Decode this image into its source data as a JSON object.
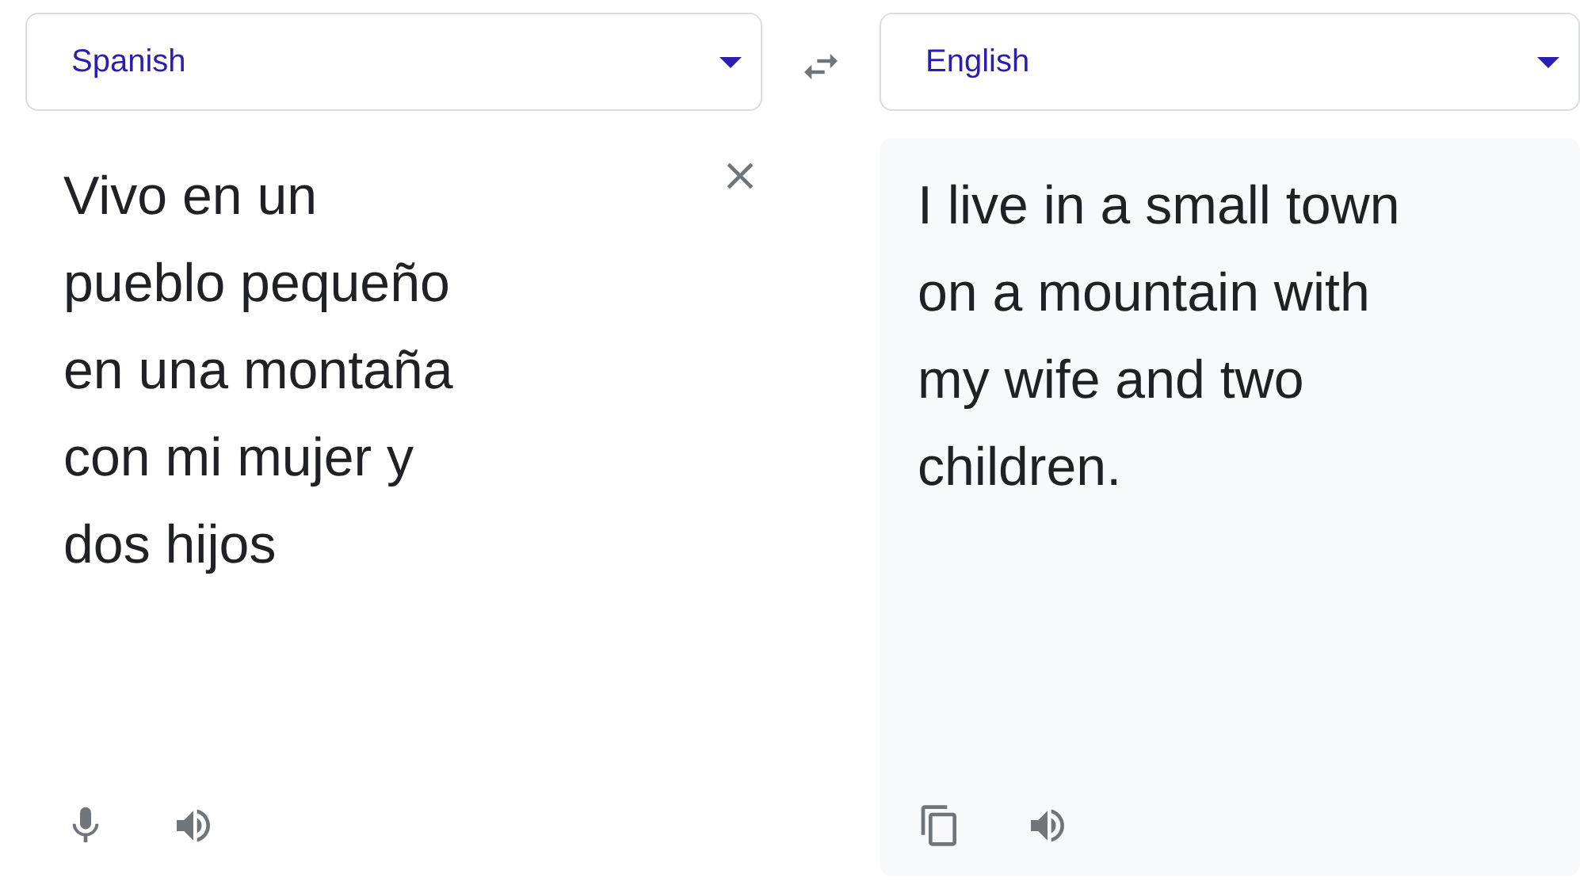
{
  "source": {
    "language": "Spanish",
    "text": "Vivo en un\npueblo pequeño\nen una montaña\ncon mi mujer y\ndos hijos"
  },
  "target": {
    "language": "English",
    "text": "I live in a small town\non a mountain with\nmy wife and two\nchildren."
  }
}
